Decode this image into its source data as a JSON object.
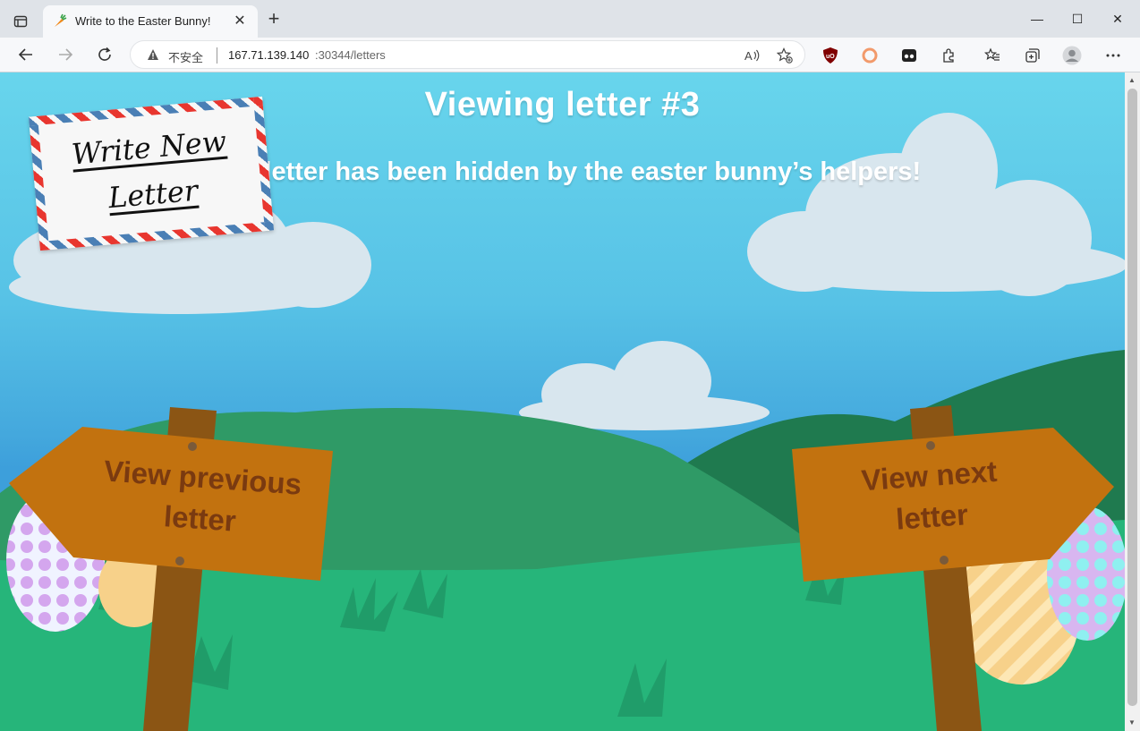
{
  "browser": {
    "tab_title": "Write to the Easter Bunny!",
    "tab_close": "✕",
    "new_tab": "+",
    "window_controls": {
      "minimize": "—",
      "maximize": "☐",
      "close": "✕"
    },
    "security_label": "不安全",
    "url_host": "167.71.139.140",
    "url_rest": ":30344/letters",
    "icons": [
      "sidebar-icon",
      "carrot-favicon",
      "back-icon",
      "forward-icon",
      "reload-icon",
      "warning-icon",
      "read-aloud-icon",
      "favorite-add-icon",
      "ublock-icon",
      "extension-circle-icon",
      "extension-dots-icon",
      "extensions-icon",
      "favorites-icon",
      "collections-icon",
      "profile-icon",
      "more-icon"
    ]
  },
  "page": {
    "heading": "Viewing letter #3",
    "message": "This letter has been hidden by the easter bunny’s helpers!",
    "write_new_label": "Write New Letter",
    "write_new_line1": "Write New",
    "write_new_line2": "Letter",
    "prev_line1": "View previous",
    "prev_line2": "letter",
    "next_line1": "View next",
    "next_line2": "letter"
  },
  "colors": {
    "sky_top": "#68d5ec",
    "hill_dark": "#1f7a4f",
    "hill_mid": "#2f9a66",
    "grass": "#26b57a",
    "sign_wood": "#c2720f",
    "post_wood": "#8b5514",
    "sign_text": "#7a3a10"
  }
}
